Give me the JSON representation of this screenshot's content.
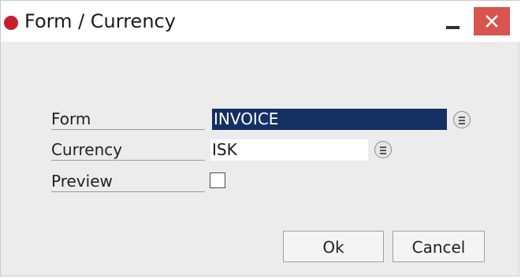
{
  "window": {
    "title": "Form / Currency"
  },
  "title_buttons": {
    "minimize": "minimize",
    "close": "close"
  },
  "fields": {
    "form": {
      "label": "Form",
      "value": "INVOICE"
    },
    "currency": {
      "label": "Currency",
      "value": "ISK"
    },
    "preview": {
      "label": "Preview",
      "checked": false
    }
  },
  "buttons": {
    "ok": "Ok",
    "cancel": "Cancel"
  },
  "colors": {
    "title_dot": "#c81e2c",
    "close_button": "#d9534f",
    "selected_field": "#143063"
  },
  "icons": {
    "title_status": "red-dot-icon",
    "minimize": "minimize-icon",
    "close": "close-icon",
    "lookup": "list-lookup-icon"
  }
}
